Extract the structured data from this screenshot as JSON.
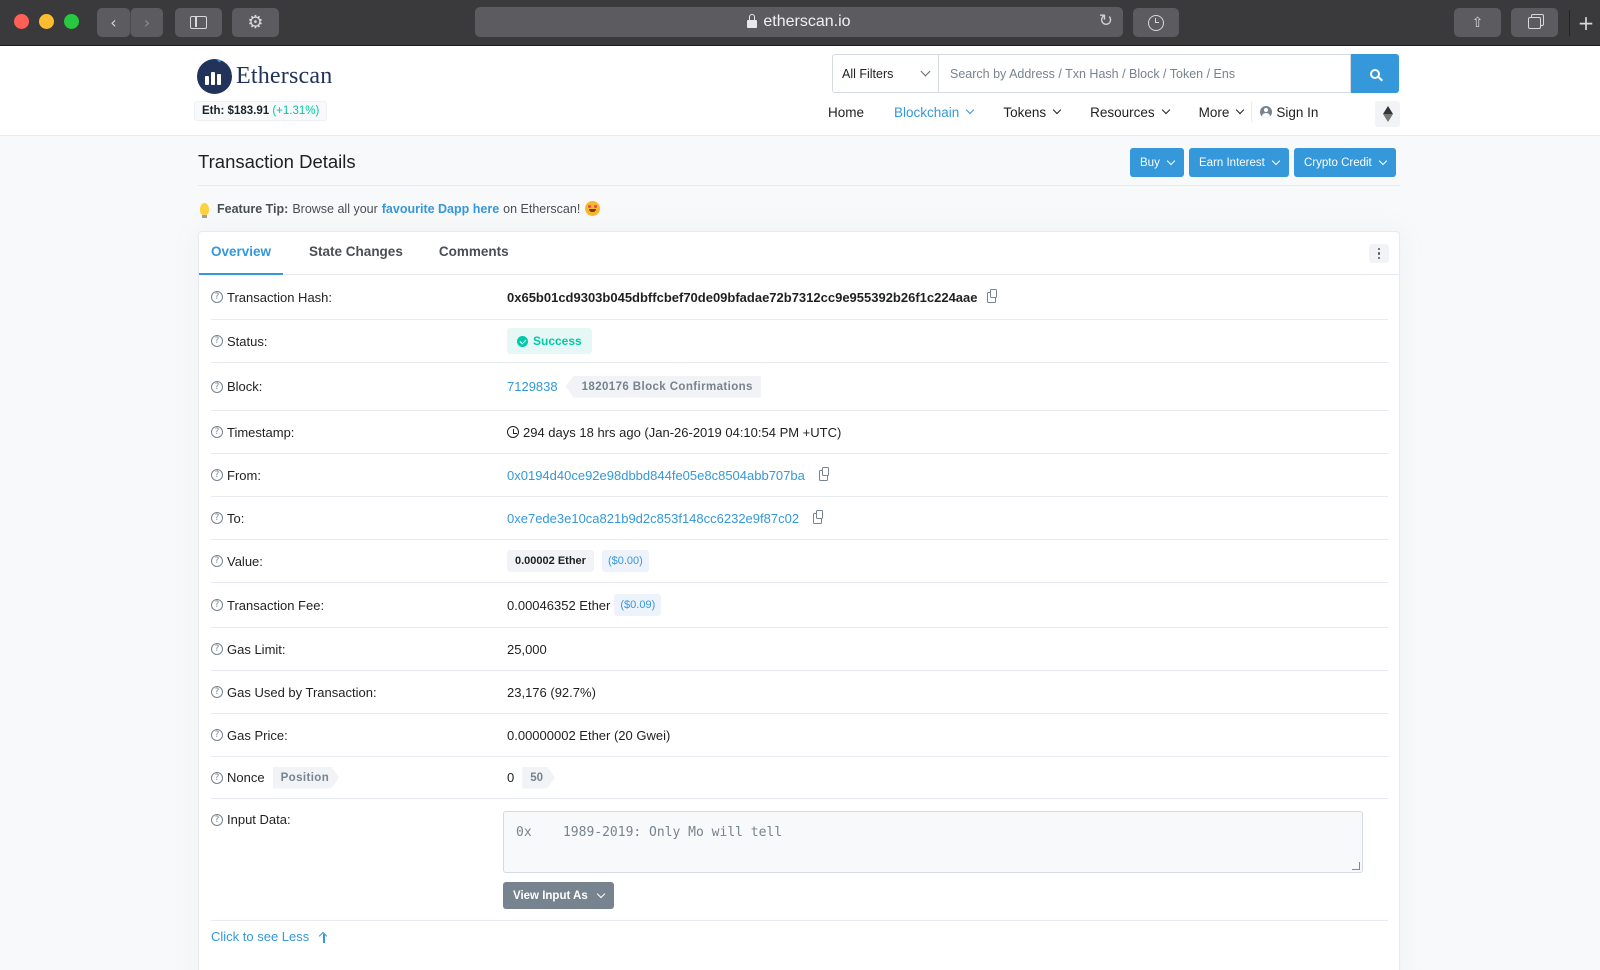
{
  "browser": {
    "url": "etherscan.io"
  },
  "header": {
    "logo_text": "Etherscan",
    "eth_price_label": "Eth: $183.91",
    "eth_price_change": "(+1.31%)",
    "search": {
      "filter": "All Filters",
      "placeholder": "Search by Address / Txn Hash / Block / Token / Ens"
    },
    "nav": {
      "home": "Home",
      "blockchain": "Blockchain",
      "tokens": "Tokens",
      "resources": "Resources",
      "more": "More",
      "sign_in": "Sign In"
    }
  },
  "page": {
    "title": "Transaction Details",
    "actions": {
      "buy": "Buy",
      "earn_interest": "Earn Interest",
      "crypto_credit": "Crypto Credit"
    },
    "tip": {
      "label": "Feature Tip:",
      "text_before": "Browse all your",
      "link": "favourite Dapp here",
      "text_after": "on Etherscan!"
    },
    "tabs": {
      "overview": "Overview",
      "state_changes": "State Changes",
      "comments": "Comments"
    }
  },
  "details": {
    "tx_hash_label": "Transaction Hash:",
    "tx_hash": "0x65b01cd9303b045dbffcbef70de09bfadae72b7312cc9e955392b26f1c224aae",
    "status_label": "Status:",
    "status": "Success",
    "block_label": "Block:",
    "block": "7129838",
    "confirmations": "1820176 Block Confirmations",
    "timestamp_label": "Timestamp:",
    "timestamp": "294 days 18 hrs ago (Jan-26-2019 04:10:54 PM +UTC)",
    "from_label": "From:",
    "from": "0x0194d40ce92e98dbbd844fe05e8c8504abb707ba",
    "to_label": "To:",
    "to": "0xe7ede3e10ca821b9d2c853f148cc6232e9f87c02",
    "value_label": "Value:",
    "value": "0.00002 Ether",
    "value_usd": "($0.00)",
    "fee_label": "Transaction Fee:",
    "fee": "0.00046352 Ether",
    "fee_usd": "($0.09)",
    "gas_limit_label": "Gas Limit:",
    "gas_limit": "25,000",
    "gas_used_label": "Gas Used by Transaction:",
    "gas_used": "23,176 (92.7%)",
    "gas_price_label": "Gas Price:",
    "gas_price": "0.00000002 Ether (20 Gwei)",
    "nonce_label": "Nonce",
    "position_label": "Position",
    "nonce": "0",
    "position": "50",
    "input_label": "Input Data:",
    "input_data": "0x    1989-2019: Only Mo will tell",
    "view_input_as": "View Input As",
    "see_less": "Click to see Less"
  }
}
